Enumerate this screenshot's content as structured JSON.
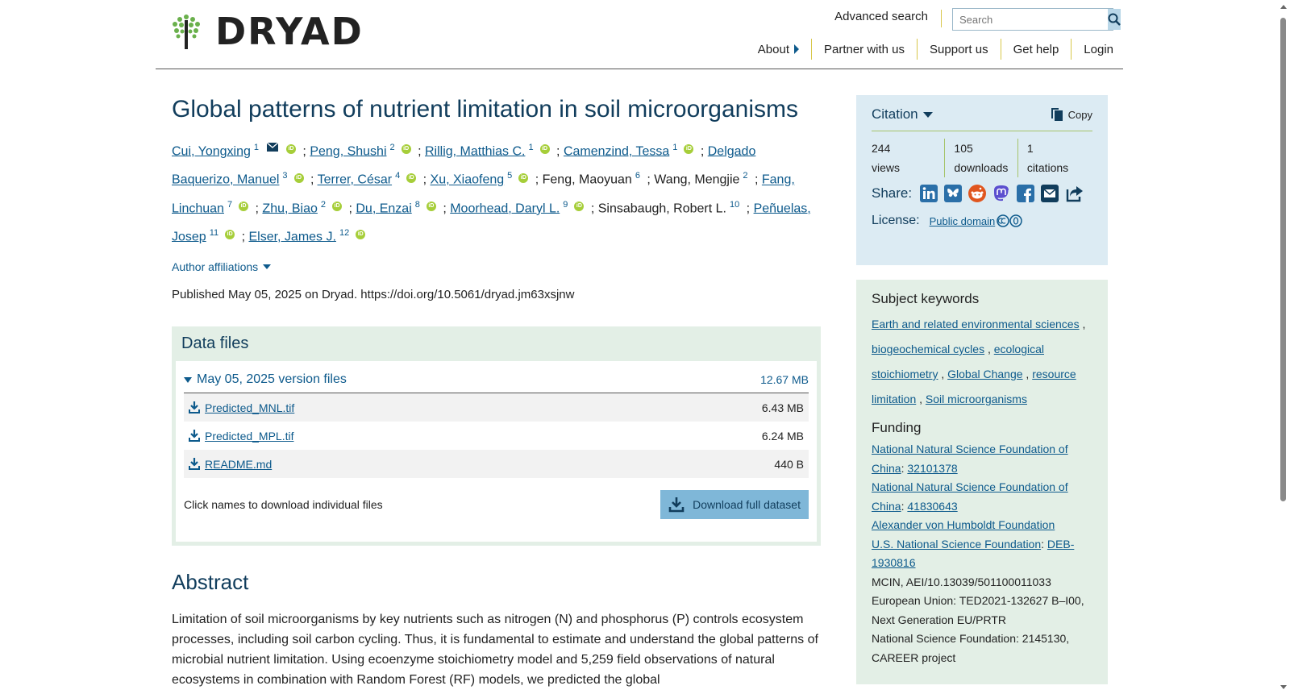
{
  "header": {
    "logo_text": "DRYAD",
    "advanced_search": "Advanced search",
    "search_placeholder": "Search",
    "nav": {
      "about": "About",
      "partner": "Partner with us",
      "support": "Support us",
      "help": "Get help",
      "login": "Login"
    }
  },
  "article": {
    "title": "Global patterns of nutrient limitation in soil microorganisms",
    "authors": [
      {
        "name": "Cui, Yongxing",
        "sup": "1",
        "linked": true,
        "mail": true,
        "orcid": true
      },
      {
        "name": "Peng, Shushi",
        "sup": "2",
        "linked": true,
        "orcid": true
      },
      {
        "name": "Rillig, Matthias C.",
        "sup": "1",
        "linked": true,
        "orcid": true
      },
      {
        "name": "Camenzind, Tessa",
        "sup": "1",
        "linked": true,
        "orcid": true
      },
      {
        "name": "Delgado Baquerizo, Manuel",
        "sup": "3",
        "linked": true,
        "orcid": true
      },
      {
        "name": "Terrer, César",
        "sup": "4",
        "linked": true,
        "orcid": true
      },
      {
        "name": "Xu, Xiaofeng",
        "sup": "5",
        "linked": true,
        "orcid": true
      },
      {
        "name": "Feng, Maoyuan",
        "sup": "6",
        "linked": false,
        "orcid": false
      },
      {
        "name": "Wang, Mengjie",
        "sup": "2",
        "linked": false,
        "orcid": false
      },
      {
        "name": "Fang, Linchuan",
        "sup": "7",
        "linked": true,
        "orcid": true
      },
      {
        "name": "Zhu, Biao",
        "sup": "2",
        "linked": true,
        "orcid": true
      },
      {
        "name": "Du, Enzai",
        "sup": "8",
        "linked": true,
        "orcid": true
      },
      {
        "name": "Moorhead, Daryl L.",
        "sup": "9",
        "linked": true,
        "orcid": true
      },
      {
        "name": "Sinsabaugh, Robert L.",
        "sup": "10",
        "linked": false,
        "orcid": false
      },
      {
        "name": "Peñuelas, Josep",
        "sup": "11",
        "linked": true,
        "orcid": true
      },
      {
        "name": "Elser, James J.",
        "sup": "12",
        "linked": true,
        "orcid": true
      }
    ],
    "orcid_label": "iD",
    "affiliations_toggle": "Author affiliations",
    "published": "Published May 05, 2025 on Dryad. https://doi.org/10.5061/dryad.jm63xsjnw"
  },
  "data_files": {
    "heading": "Data files",
    "version_label": "May 05, 2025 version files",
    "version_size": "12.67 MB",
    "files": [
      {
        "name": "Predicted_MNL.tif",
        "size": "6.43 MB"
      },
      {
        "name": "Predicted_MPL.tif",
        "size": "6.24 MB"
      },
      {
        "name": "README.md",
        "size": "440 B"
      }
    ],
    "hint": "Click names to download individual files",
    "download_full": "Download full dataset"
  },
  "abstract": {
    "heading": "Abstract",
    "text": "Limitation of soil microorganisms by key nutrients such as nitrogen (N) and phosphorus (P) controls ecosystem processes, including soil carbon cycling. Thus, it is fundamental to estimate and understand the global patterns of microbial nutrient limitation. Using ecoenzyme stoichiometry model and 5,259 field observations of natural ecosystems in combination with Random Forest (RF) models, we predicted the global"
  },
  "citation": {
    "heading": "Citation",
    "copy": "Copy",
    "stats": [
      {
        "value": "244",
        "label": "views"
      },
      {
        "value": "105",
        "label": "downloads"
      },
      {
        "value": "1",
        "label": "citations"
      }
    ],
    "share_label": "Share:",
    "share_icons": [
      "linkedin-icon",
      "bluesky-icon",
      "reddit-icon",
      "mastodon-icon",
      "facebook-icon",
      "email-icon",
      "share-icon"
    ],
    "license_label": "License:",
    "license_value": "Public domain"
  },
  "keywords": {
    "heading": "Subject keywords",
    "items": [
      "Earth and related environmental sciences",
      "biogeochemical cycles",
      "ecological stoichiometry",
      "Global Change",
      "resource limitation",
      "Soil microorganisms"
    ]
  },
  "funding": {
    "heading": "Funding",
    "lines": [
      {
        "org": "National Natural Science Foundation of China",
        "org_linked": true,
        "award": "32101378"
      },
      {
        "org": "National Natural Science Foundation of China",
        "org_linked": true,
        "award": "41830643"
      },
      {
        "org": "Alexander von Humboldt Foundation",
        "org_linked": true,
        "award": ""
      },
      {
        "org": "U.S. National Science Foundation",
        "org_linked": true,
        "award": "DEB-1930816"
      },
      {
        "org": "MCIN, AEI/10.13039/501100011033",
        "org_linked": false,
        "award": ""
      },
      {
        "org": "European Union: TED2021-132627 B–I00, Next Generation EU/PRTR",
        "org_linked": false,
        "award": ""
      },
      {
        "org": "National Science Foundation: 2145130, CAREER project",
        "org_linked": false,
        "award": ""
      }
    ]
  },
  "colors": {
    "link": "#0d5a8c",
    "heading": "#113d5c",
    "citation_bg": "#dcebf3",
    "keywords_bg": "#e3efe6",
    "orcid": "#a6ce39",
    "button": "#7fb7d8"
  }
}
